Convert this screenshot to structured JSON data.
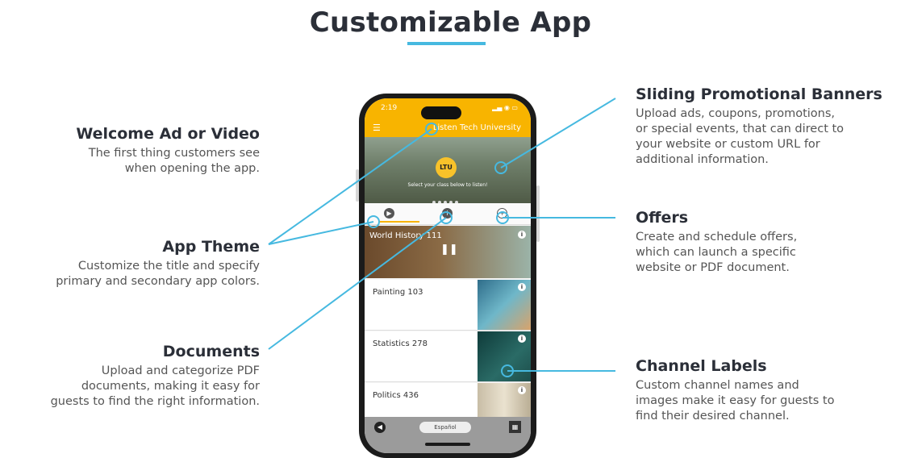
{
  "title": "Customizable App",
  "colors": {
    "accent": "#46b9e0",
    "app_primary": "#f8b400",
    "heading": "#2b2f38"
  },
  "features": {
    "welcome": {
      "title": "Welcome Ad or Video",
      "lines": [
        "The first thing customers see",
        "when opening the app."
      ]
    },
    "theme": {
      "title": "App Theme",
      "lines": [
        "Customize the title and specify",
        "primary and secondary app colors."
      ]
    },
    "documents": {
      "title": "Documents",
      "lines": [
        "Upload and categorize PDF",
        "documents, making it easy for",
        "guests to find the right information."
      ]
    },
    "banners": {
      "title": "Sliding Promotional Banners",
      "lines": [
        "Upload ads, coupons, promotions,",
        "or special events, that can direct to",
        "your website or custom URL for",
        "additional information."
      ]
    },
    "offers": {
      "title": "Offers",
      "lines": [
        "Create and schedule offers,",
        "which can launch a specific",
        "website or PDF document."
      ]
    },
    "channels": {
      "title": "Channel Labels",
      "lines": [
        "Custom channel names and",
        "images make it easy for guests to",
        "find their desired channel."
      ]
    }
  },
  "phone": {
    "time": "2:19",
    "university": "Listen Tech University",
    "logo": "LTU",
    "banner_caption": "Select your class below to listen!",
    "channels": [
      "World History 111",
      "Painting 103",
      "Statistics 278",
      "Politics 436"
    ],
    "language": "Español"
  }
}
